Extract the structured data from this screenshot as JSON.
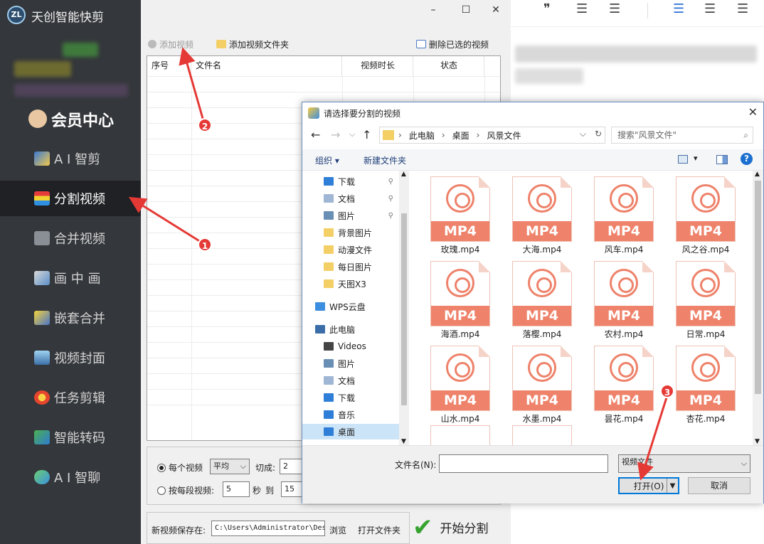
{
  "app": {
    "title": "天创智能快剪",
    "logo": "ZL"
  },
  "sidebar": {
    "vip": "会员中心",
    "items": [
      {
        "label": "A I 智剪",
        "icon": "wand-icon"
      },
      {
        "label": "分割视频",
        "icon": "split-icon"
      },
      {
        "label": "合并视频",
        "icon": "merge-icon"
      },
      {
        "label": "画 中 画",
        "icon": "pip-icon"
      },
      {
        "label": "嵌套合并",
        "icon": "nest-icon"
      },
      {
        "label": "视频封面",
        "icon": "cover-icon"
      },
      {
        "label": "任务剪辑",
        "icon": "task-icon"
      },
      {
        "label": "智能转码",
        "icon": "transcode-icon"
      },
      {
        "label": "A I 智聊",
        "icon": "chat-icon"
      }
    ],
    "active_index": 1
  },
  "window_controls": {
    "minimize": "–",
    "maximize": "☐",
    "close": "✕"
  },
  "toolbar": {
    "add_video": "添加视频",
    "add_folder": "添加视频文件夹",
    "delete_selected": "删除已选的视频"
  },
  "table": {
    "headers": [
      "序号",
      "文件名",
      "视频时长",
      "状态"
    ]
  },
  "options": {
    "each_video": "每个视频",
    "mode_select": "平均",
    "cut_label": "切成:",
    "cut_value": "2",
    "by_segment": "按每段视频:",
    "seg_from": "5",
    "seconds": "秒",
    "to": "到",
    "seg_to": "15"
  },
  "save": {
    "label": "新视频保存在:",
    "path": "C:\\Users\\Administrator\\Des",
    "browse": "浏览",
    "open_folder": "打开文件夹"
  },
  "start": {
    "label": "开始分割"
  },
  "dialog": {
    "title": "请选择要分割的视频",
    "close": "✕",
    "breadcrumb": [
      "此电脑",
      "桌面",
      "风景文件"
    ],
    "search_placeholder": "搜索\"风景文件\"",
    "organize": "组织 ▾",
    "new_folder": "新建文件夹",
    "tree": [
      {
        "label": "下载",
        "icon": "download-icon",
        "pinned": true
      },
      {
        "label": "文档",
        "icon": "document-icon",
        "pinned": true
      },
      {
        "label": "图片",
        "icon": "picture-icon",
        "pinned": true
      },
      {
        "label": "背景图片",
        "icon": "folder-icon",
        "pinned": false
      },
      {
        "label": "动漫文件",
        "icon": "folder-icon",
        "pinned": false
      },
      {
        "label": "每日图片",
        "icon": "folder-icon",
        "pinned": false
      },
      {
        "label": "天图X3",
        "icon": "folder-icon",
        "pinned": false
      },
      {
        "label": "WPS云盘",
        "icon": "cloud-icon",
        "pinned": false
      },
      {
        "label": "此电脑",
        "icon": "computer-icon",
        "pinned": false
      },
      {
        "label": "Videos",
        "icon": "video-folder-icon",
        "pinned": false
      },
      {
        "label": "图片",
        "icon": "picture-icon",
        "pinned": false
      },
      {
        "label": "文档",
        "icon": "document-icon",
        "pinned": false
      },
      {
        "label": "下载",
        "icon": "download-icon",
        "pinned": false
      },
      {
        "label": "音乐",
        "icon": "music-icon",
        "pinned": false
      },
      {
        "label": "桌面",
        "icon": "desktop-icon",
        "pinned": false
      }
    ],
    "selected_tree": 14,
    "files": [
      "玫瑰.mp4",
      "大海.mp4",
      "风车.mp4",
      "风之谷.mp4",
      "海酒.mp4",
      "落樱.mp4",
      "农村.mp4",
      "日常.mp4",
      "山水.mp4",
      "水墨.mp4",
      "昙花.mp4",
      "杏花.mp4"
    ],
    "file_badge": "MP4",
    "filename_label": "文件名(N):",
    "filename_value": "",
    "filetype": "视频文件",
    "open": "打开(O)",
    "cancel": "取消"
  },
  "annotations": [
    "1",
    "2",
    "3"
  ],
  "colors": {
    "sidebar": "#34373b",
    "accent": "#ee826a",
    "badge": "#e53935"
  }
}
